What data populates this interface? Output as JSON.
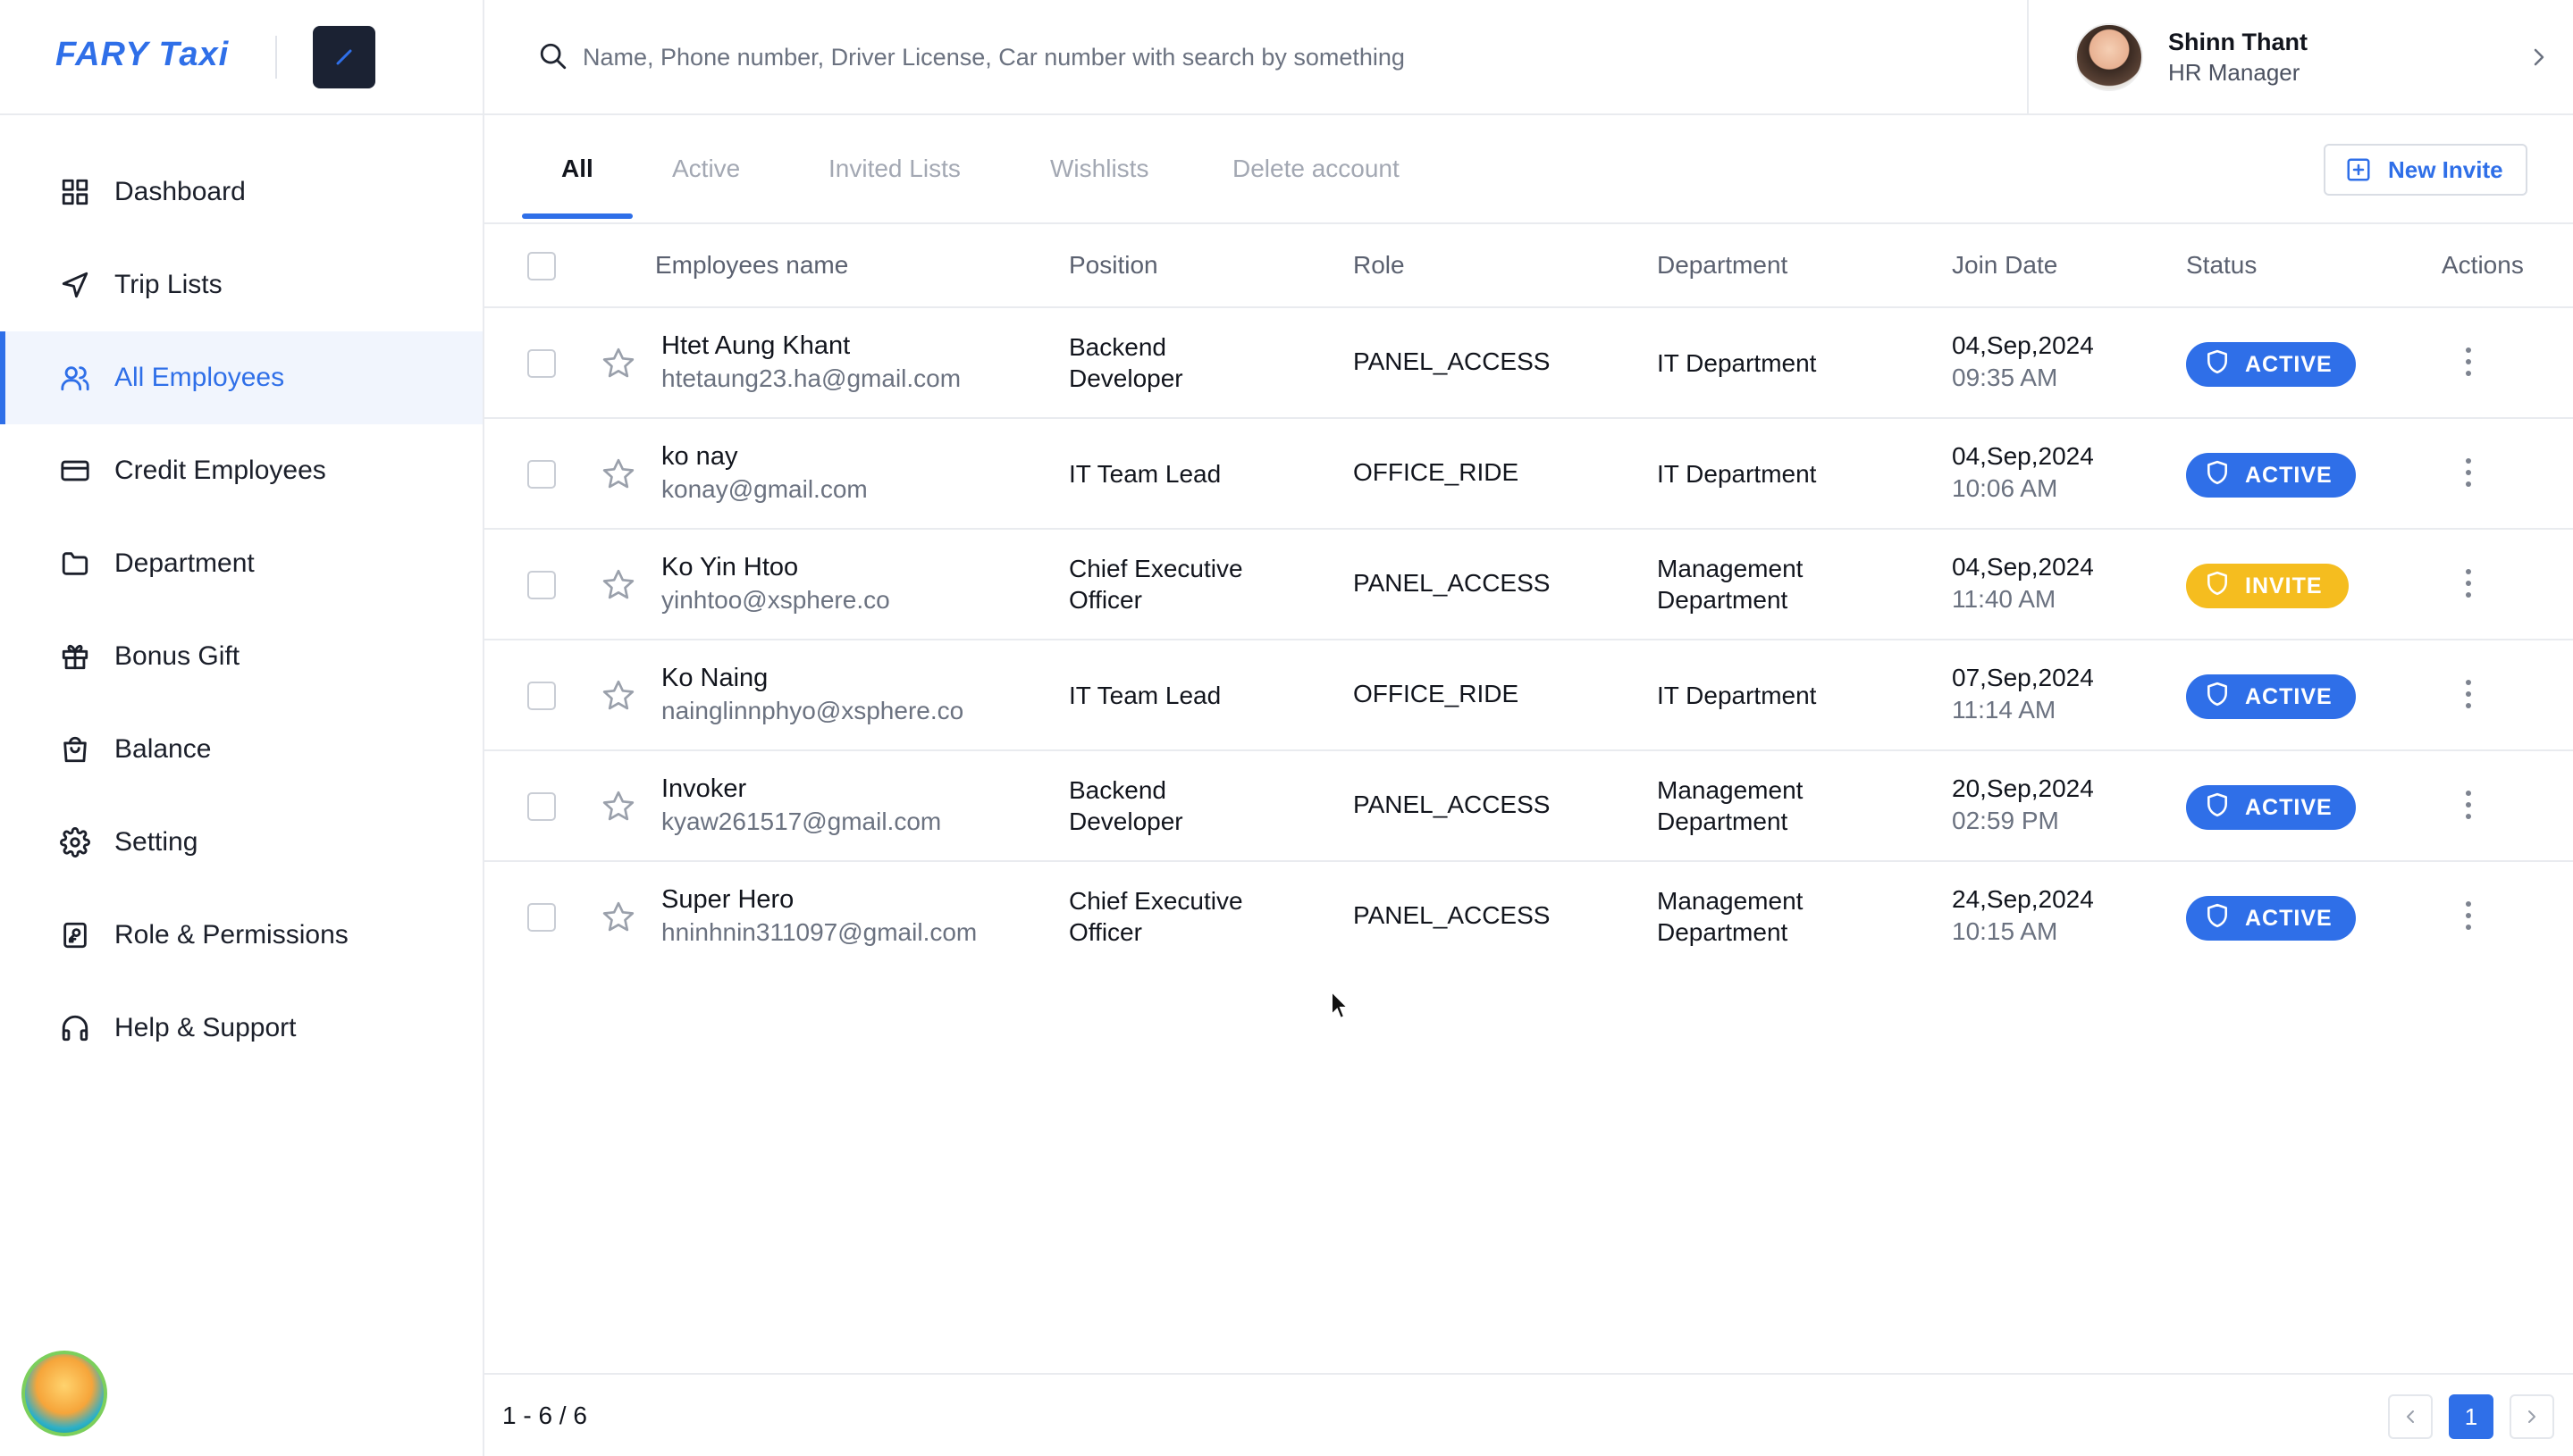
{
  "app": {
    "logo_text": "FARY Taxi",
    "brand_color": "#2f6fe8"
  },
  "sidebar": {
    "items": [
      {
        "label": "Dashboard",
        "icon": "dashboard-icon"
      },
      {
        "label": "Trip Lists",
        "icon": "send-icon"
      },
      {
        "label": "All Employees",
        "icon": "users-icon",
        "active": true
      },
      {
        "label": "Credit Employees",
        "icon": "credit-card-icon"
      },
      {
        "label": "Department",
        "icon": "folder-icon"
      },
      {
        "label": "Bonus Gift",
        "icon": "gift-icon"
      },
      {
        "label": "Balance",
        "icon": "shopping-bag-icon"
      },
      {
        "label": "Setting",
        "icon": "gear-icon"
      },
      {
        "label": "Role & Permissions",
        "icon": "permission-icon"
      },
      {
        "label": "Help & Support",
        "icon": "headphones-icon"
      }
    ]
  },
  "header": {
    "search_placeholder": "Name, Phone number, Driver License, Car number with search by something",
    "user": {
      "name": "Shinn Thant",
      "role": "HR Manager"
    }
  },
  "tabs": {
    "items": [
      "All",
      "Active",
      "Invited Lists",
      "Wishlists",
      "Delete account"
    ],
    "active": "All",
    "new_invite_label": "New Invite"
  },
  "table": {
    "columns": [
      "Employees name",
      "Position",
      "Role",
      "Department",
      "Join Date",
      "Status",
      "Actions"
    ],
    "rows": [
      {
        "name": "Htet Aung Khant",
        "email": "htetaung23.ha@gmail.com",
        "position": [
          "Backend",
          "Developer"
        ],
        "role": "PANEL_ACCESS",
        "department": [
          "IT Department"
        ],
        "date": "04,Sep,2024",
        "time": "09:35 AM",
        "status": "ACTIVE"
      },
      {
        "name": "ko nay",
        "email": "konay@gmail.com",
        "position": [
          "IT Team Lead"
        ],
        "role": "OFFICE_RIDE",
        "department": [
          "IT Department"
        ],
        "date": "04,Sep,2024",
        "time": "10:06 AM",
        "status": "ACTIVE"
      },
      {
        "name": "Ko Yin Htoo",
        "email": "yinhtoo@xsphere.co",
        "position": [
          "Chief Executive",
          "Officer"
        ],
        "role": "PANEL_ACCESS",
        "department": [
          "Management",
          "Department"
        ],
        "date": "04,Sep,2024",
        "time": "11:40 AM",
        "status": "INVITE"
      },
      {
        "name": "Ko Naing",
        "email": "nainglinnphyo@xsphere.co",
        "position": [
          "IT Team Lead"
        ],
        "role": "OFFICE_RIDE",
        "department": [
          "IT Department"
        ],
        "date": "07,Sep,2024",
        "time": "11:14 AM",
        "status": "ACTIVE"
      },
      {
        "name": "Invoker",
        "email": "kyaw261517@gmail.com",
        "position": [
          "Backend",
          "Developer"
        ],
        "role": "PANEL_ACCESS",
        "department": [
          "Management",
          "Department"
        ],
        "date": "20,Sep,2024",
        "time": "02:59 PM",
        "status": "ACTIVE"
      },
      {
        "name": "Super Hero",
        "email": "hninhnin311097@gmail.com",
        "position": [
          "Chief Executive",
          "Officer"
        ],
        "role": "PANEL_ACCESS",
        "department": [
          "Management",
          "Department"
        ],
        "date": "24,Sep,2024",
        "time": "10:15 AM",
        "status": "ACTIVE"
      }
    ],
    "status_colors": {
      "ACTIVE": "#2f6fe8",
      "INVITE": "#f5bd1f"
    }
  },
  "pagination": {
    "range_text": "1 - 6 / 6",
    "current_page": "1",
    "prev_icon": "chevron-left-icon",
    "next_icon": "chevron-right-icon"
  }
}
